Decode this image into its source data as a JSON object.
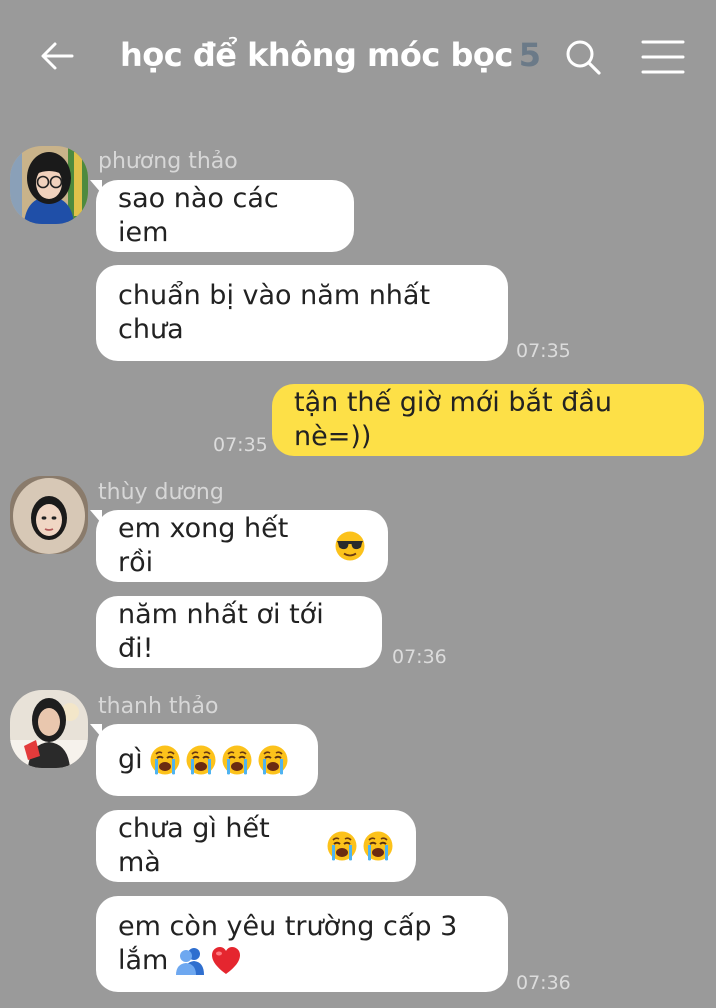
{
  "header": {
    "title": "học để không móc bọc",
    "member_count": "5",
    "icons": [
      "back-arrow-icon",
      "search-icon",
      "menu-icon"
    ]
  },
  "colors": {
    "background": "#9a9a9a",
    "incoming_bubble": "#ffffff",
    "outgoing_bubble": "#fde047",
    "member_count": "#6b7a88"
  },
  "messages": [
    {
      "sender": "phương thảo",
      "text": "sao nào các iem"
    },
    {
      "text": "chuẩn bị vào năm nhất chưa",
      "lines": [
        "chuẩn bị vào năm nhất",
        "chưa"
      ],
      "time": "07:35"
    },
    {
      "outgoing": true,
      "text": "tận thế giờ mới bắt đầu nè=))",
      "time": "07:35"
    },
    {
      "sender": "thùy dương",
      "text": "em xong hết rồi",
      "emoji": [
        "sunglasses-emoji"
      ]
    },
    {
      "text": "năm nhất ơi tới đi!",
      "time": "07:36"
    },
    {
      "sender": "thanh thảo",
      "text": "gì",
      "emoji": [
        "crying-emoji",
        "crying-emoji",
        "crying-emoji",
        "crying-emoji"
      ]
    },
    {
      "text": "chưa gì hết mà",
      "emoji": [
        "crying-emoji",
        "crying-emoji"
      ]
    },
    {
      "text": "em còn yêu trường cấp 3 lắm",
      "lines": [
        "em còn yêu trường cấp 3",
        "lắm"
      ],
      "emoji": [
        "people-hugging-emoji",
        "red-heart-emoji"
      ],
      "time": "07:36"
    }
  ]
}
